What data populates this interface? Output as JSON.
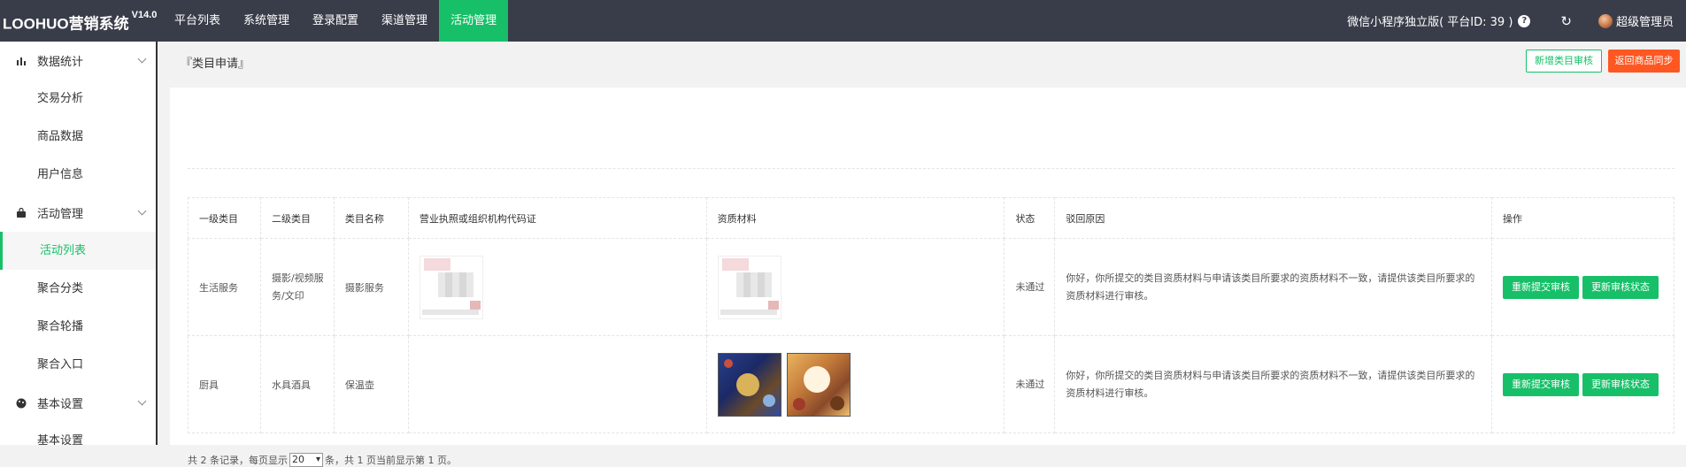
{
  "brand": {
    "name": "LOOHUO营销系统",
    "version": "V14.0"
  },
  "topnav": [
    "平台列表",
    "系统管理",
    "登录配置",
    "渠道管理",
    "活动管理"
  ],
  "topnav_active": 4,
  "topbar": {
    "platform": "微信小程序独立版( 平台ID: 39 )",
    "user": "超级管理员"
  },
  "sidebar": {
    "groups": [
      {
        "label": "数据统计",
        "icon": "bar-chart-icon",
        "items": [
          "交易分析",
          "商品数据",
          "用户信息"
        ]
      },
      {
        "label": "活动管理",
        "icon": "bag-icon",
        "items": [
          "活动列表",
          "聚合分类",
          "聚合轮播",
          "聚合入口"
        ]
      },
      {
        "label": "基本设置",
        "icon": "palette-icon",
        "items": [
          "基本设置"
        ]
      }
    ],
    "active_item": "活动列表"
  },
  "page": {
    "breadcrumb": "『类目申请』",
    "add_button": "新增类目审核",
    "back_button": "返回商品同步"
  },
  "table": {
    "headers": [
      "一级类目",
      "二级类目",
      "类目名称",
      "营业执照或组织机构代码证",
      "资质材料",
      "状态",
      "驳回原因",
      "操作"
    ],
    "rows": [
      {
        "cat1": "生活服务",
        "cat2": "摄影/视频服务/文印",
        "name": "摄影服务",
        "status": "未通过",
        "reason": "你好，你所提交的类目资质材料与申请该类目所要求的资质材料不一致，请提供该类目所要求的资质材料进行审核。",
        "btn_resubmit": "重新提交审核",
        "btn_update": "更新审核状态"
      },
      {
        "cat1": "厨具",
        "cat2": "水具酒具",
        "name": "保温壶",
        "status": "未通过",
        "reason": "你好，你所提交的类目资质材料与申请该类目所要求的资质材料不一致，请提供该类目所要求的资质材料进行审核。",
        "btn_resubmit": "重新提交审核",
        "btn_update": "更新审核状态"
      }
    ]
  },
  "pager": {
    "prefix": "共 2 条记录，每页显示",
    "page_size": "20",
    "suffix": "条，共 1 页当前显示第 1 页。"
  }
}
